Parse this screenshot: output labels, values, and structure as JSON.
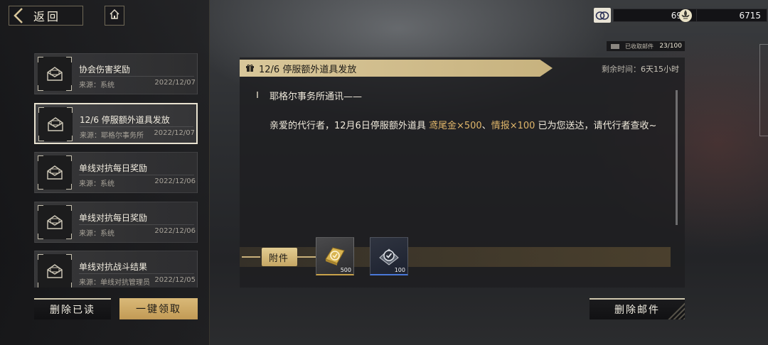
{
  "nav": {
    "back_label": "返回"
  },
  "currencies": [
    {
      "icon": "coin-icon",
      "value": "69万"
    },
    {
      "icon": "fleur-de-lis-icon",
      "value": "6715"
    }
  ],
  "mailbox": {
    "received_label": "已收取邮件",
    "received_count": "23/100"
  },
  "mail_list": [
    {
      "title": "协会伤害奖励",
      "source": "来源：系统",
      "date": "2022/12/07",
      "selected": false
    },
    {
      "title": "12/6 停服额外道具发放",
      "source": "来源：耶格尔事务所",
      "date": "2022/12/07",
      "selected": true
    },
    {
      "title": "单线对抗每日奖励",
      "source": "来源：系统",
      "date": "2022/12/06",
      "selected": false
    },
    {
      "title": "单线对抗每日奖励",
      "source": "来源：系统",
      "date": "2022/12/06",
      "selected": false
    },
    {
      "title": "单线对抗战斗结果",
      "source": "来源：单线对抗管理员",
      "date": "2022/12/05",
      "selected": false
    }
  ],
  "left_buttons": {
    "delete_read": "删除已读",
    "claim_all": "一键领取"
  },
  "mail_detail": {
    "title": "12/6 停服额外道具发放",
    "remaining_label": "剩余时间：",
    "remaining_value": "6天15小时",
    "greeting": "耶格尔事务所通讯——",
    "body_prefix": "亲爱的代行者，12月6日停服额外道具 ",
    "highlight1": "鸢尾金×500",
    "separator": "、",
    "highlight2": "情报×100",
    "body_suffix": " 已为您送达，请代行者查收~",
    "attachments_label": "附件",
    "attachments": [
      {
        "icon": "gold-bar-icon",
        "qty": "500"
      },
      {
        "icon": "intel-check-icon",
        "qty": "100"
      }
    ],
    "delete_button": "删除邮件"
  },
  "colors": {
    "accent_gold": "#d9c79a",
    "highlight": "#e0b66a",
    "rarity_blue": "#4a78d8"
  }
}
